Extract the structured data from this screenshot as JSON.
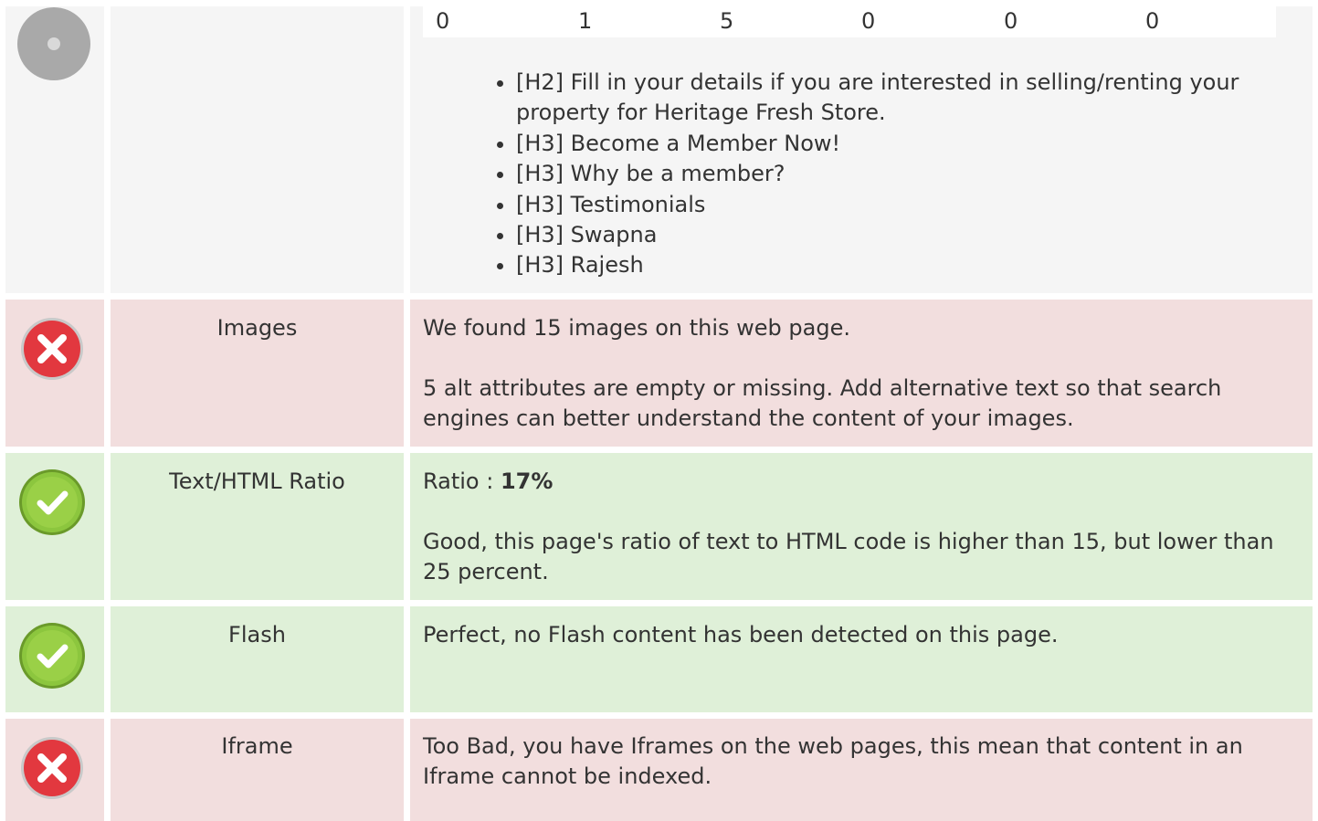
{
  "headings": {
    "counts": [
      "0",
      "1",
      "5",
      "0",
      "0",
      "0"
    ],
    "items": [
      "[H2] Fill in your details if you are interested in selling/renting your property for Heritage Fresh Store.",
      "[H3] Become a Member Now!",
      "[H3] Why be a member?",
      "[H3] Testimonials",
      "[H3] Swapna",
      "[H3] Rajesh"
    ],
    "status_icon": "neutral-circle-icon"
  },
  "images": {
    "label": "Images",
    "status_icon": "error-x-icon",
    "line1": "We found 15 images on this web page.",
    "line2": "5 alt attributes are empty or missing. Add alternative text so that search engines can better understand the content of your images."
  },
  "ratio": {
    "label": "Text/HTML Ratio",
    "status_icon": "success-check-icon",
    "prefix": "Ratio : ",
    "value": "17%",
    "description": "Good, this page's ratio of text to HTML code is higher than 15, but lower than 25 percent."
  },
  "flash": {
    "label": "Flash",
    "status_icon": "success-check-icon",
    "description": "Perfect, no Flash content has been detected on this page."
  },
  "iframe": {
    "label": "Iframe",
    "status_icon": "error-x-icon",
    "description": "Too Bad, you have Iframes on the web pages, this mean that content in an Iframe cannot be indexed."
  },
  "colors": {
    "error_bg": "#f2dede",
    "success_bg": "#dff0d8",
    "neutral_bg": "#f5f5f5",
    "error_icon": "#e2383f",
    "success_icon": "#8cc63e"
  }
}
